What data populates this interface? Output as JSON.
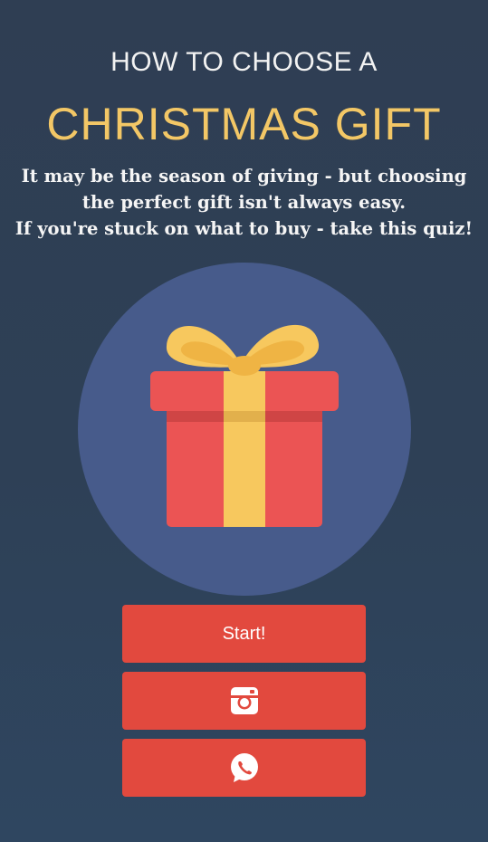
{
  "header": {
    "subtitle": "HOW TO CHOOSE A",
    "title": "CHRISTMAS GIFT"
  },
  "intro": {
    "line1": "It may be the season of giving - but choosing",
    "line2": "the perfect gift isn't always easy.",
    "line3": "If you're stuck on what to buy - take this quiz!"
  },
  "hero": {
    "icon": "gift-icon"
  },
  "buttons": {
    "start_label": "Start!",
    "instagram_icon": "instagram-icon",
    "whatsapp_icon": "whatsapp-icon"
  },
  "colors": {
    "background": "#2f4057",
    "title_accent": "#f3c766",
    "circle": "#475b8b",
    "button": "#e2493e",
    "gift_box": "#eb5454",
    "ribbon": "#f7c85e"
  }
}
